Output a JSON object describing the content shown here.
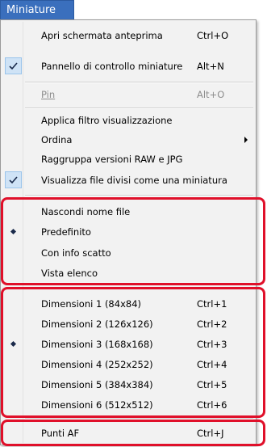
{
  "menubar": {
    "title": "Miniature"
  },
  "menu": {
    "items": [
      {
        "label": "Apri schermata anteprima",
        "shortcut": "Ctrl+O"
      },
      {
        "label": "Pannello di controllo miniature",
        "shortcut": "Alt+N",
        "checked": true
      },
      {
        "label": "Pin",
        "shortcut": "Alt+O",
        "disabled": true
      },
      {
        "label": "Applica filtro visualizzazione",
        "shortcut": ""
      },
      {
        "label": "Ordina",
        "shortcut": "",
        "submenu": true
      },
      {
        "label": "Raggruppa versioni RAW e JPG",
        "shortcut": ""
      },
      {
        "label": "Visualizza file divisi come una miniatura",
        "shortcut": "",
        "checked": true
      },
      {
        "label": "Nascondi nome file",
        "shortcut": ""
      },
      {
        "label": "Predefinito",
        "shortcut": "",
        "selected": true
      },
      {
        "label": "Con info scatto",
        "shortcut": ""
      },
      {
        "label": "Vista elenco",
        "shortcut": ""
      },
      {
        "label": "Dimensioni 1 (84x84)",
        "shortcut": "Ctrl+1"
      },
      {
        "label": "Dimensioni 2 (126x126)",
        "shortcut": "Ctrl+2"
      },
      {
        "label": "Dimensioni 3 (168x168)",
        "shortcut": "Ctrl+3",
        "selected": true
      },
      {
        "label": "Dimensioni 4 (252x252)",
        "shortcut": "Ctrl+4"
      },
      {
        "label": "Dimensioni 5 (384x384)",
        "shortcut": "Ctrl+5"
      },
      {
        "label": "Dimensioni 6 (512x512)",
        "shortcut": "Ctrl+6"
      },
      {
        "label": "Punti AF",
        "shortcut": "Ctrl+J"
      }
    ]
  },
  "colors": {
    "menu_title_bg": "#3a6fbd",
    "menu_bg": "#f2f2f2",
    "check_bg": "#cfe3f6",
    "highlight": "#e0102a",
    "disabled_text": "#8d8d8d"
  }
}
